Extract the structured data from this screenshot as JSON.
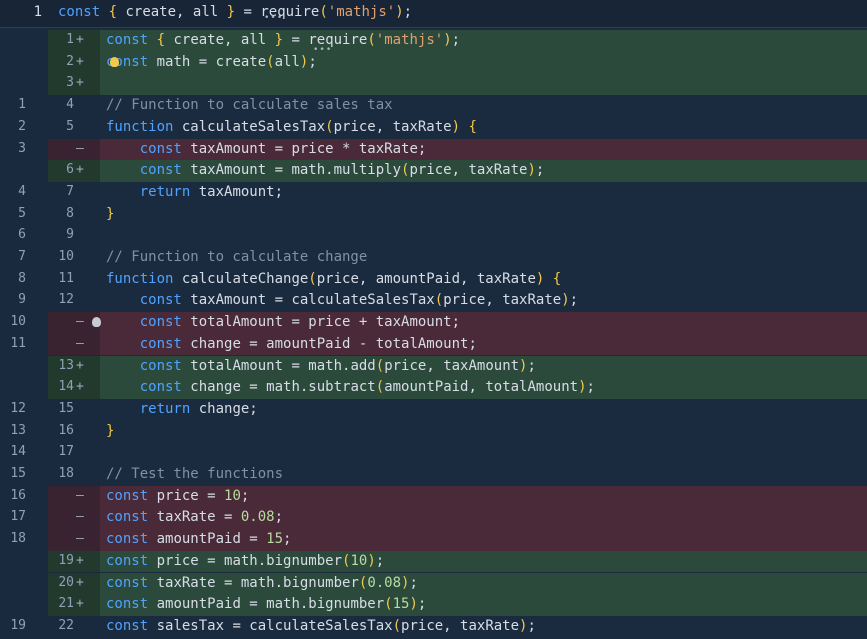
{
  "top_line": {
    "number": "1",
    "code": "const { create, all } = require('mathjs');"
  },
  "diff": [
    {
      "old": "",
      "new": "1",
      "mark": "+",
      "type": "added",
      "code": "const { create, all } = require('mathjs');"
    },
    {
      "old": "",
      "new": "2",
      "mark": "+",
      "type": "added",
      "code": "const math = create(all);"
    },
    {
      "old": "",
      "new": "3",
      "mark": "+",
      "type": "added",
      "code": ""
    },
    {
      "old": "1",
      "new": "4",
      "mark": "",
      "type": "same",
      "code": "// Function to calculate sales tax"
    },
    {
      "old": "2",
      "new": "5",
      "mark": "",
      "type": "same",
      "code": "function calculateSalesTax(price, taxRate) {"
    },
    {
      "old": "3",
      "new": "",
      "mark": "—",
      "type": "removed",
      "code": "    const taxAmount = price * taxRate;"
    },
    {
      "old": "",
      "new": "6",
      "mark": "+",
      "type": "added",
      "code": "    const taxAmount = math.multiply(price, taxRate);"
    },
    {
      "old": "4",
      "new": "7",
      "mark": "",
      "type": "same",
      "code": "    return taxAmount;"
    },
    {
      "old": "5",
      "new": "8",
      "mark": "",
      "type": "same",
      "code": "}"
    },
    {
      "old": "6",
      "new": "9",
      "mark": "",
      "type": "same",
      "code": ""
    },
    {
      "old": "7",
      "new": "10",
      "mark": "",
      "type": "same",
      "code": "// Function to calculate change"
    },
    {
      "old": "8",
      "new": "11",
      "mark": "",
      "type": "same",
      "code": "function calculateChange(price, amountPaid, taxRate) {"
    },
    {
      "old": "9",
      "new": "12",
      "mark": "",
      "type": "same",
      "code": "    const taxAmount = calculateSalesTax(price, taxRate);"
    },
    {
      "old": "10",
      "new": "",
      "mark": "—",
      "type": "removed",
      "code": "    const totalAmount = price + taxAmount;"
    },
    {
      "old": "11",
      "new": "",
      "mark": "—",
      "type": "removed",
      "code": "    const change = amountPaid - totalAmount;"
    },
    {
      "old": "",
      "new": "13",
      "mark": "+",
      "type": "added",
      "code": "    const totalAmount = math.add(price, taxAmount);"
    },
    {
      "old": "",
      "new": "14",
      "mark": "+",
      "type": "added",
      "code": "    const change = math.subtract(amountPaid, totalAmount);"
    },
    {
      "old": "12",
      "new": "15",
      "mark": "",
      "type": "same",
      "code": "    return change;"
    },
    {
      "old": "13",
      "new": "16",
      "mark": "",
      "type": "same",
      "code": "}"
    },
    {
      "old": "14",
      "new": "17",
      "mark": "",
      "type": "same",
      "code": ""
    },
    {
      "old": "15",
      "new": "18",
      "mark": "",
      "type": "same",
      "code": "// Test the functions"
    },
    {
      "old": "16",
      "new": "",
      "mark": "—",
      "type": "removed",
      "code": "const price = 10;"
    },
    {
      "old": "17",
      "new": "",
      "mark": "—",
      "type": "removed",
      "code": "const taxRate = 0.08;"
    },
    {
      "old": "18",
      "new": "",
      "mark": "—",
      "type": "removed",
      "code": "const amountPaid = 15;"
    },
    {
      "old": "",
      "new": "19",
      "mark": "+",
      "type": "added",
      "code": "const price = math.bignumber(10);"
    },
    {
      "old": "",
      "new": "20",
      "mark": "+",
      "type": "added",
      "code": "const taxRate = math.bignumber(0.08);"
    },
    {
      "old": "",
      "new": "21",
      "mark": "+",
      "type": "added",
      "code": "const amountPaid = math.bignumber(15);"
    },
    {
      "old": "19",
      "new": "22",
      "mark": "",
      "type": "same",
      "code": "const salesTax = calculateSalesTax(price, taxRate);"
    }
  ],
  "colors": {
    "added_bg": "#2b4a3c",
    "removed_bg": "#4a2a38",
    "keyword": "#4fa3ff",
    "comment": "#7f91a6",
    "string": "#e0a070",
    "bracket": "#f2c94c"
  },
  "icons": {
    "lightbulb_added_line": "lightbulb-icon",
    "lightbulb_removed_line": "lightbulb-icon"
  }
}
